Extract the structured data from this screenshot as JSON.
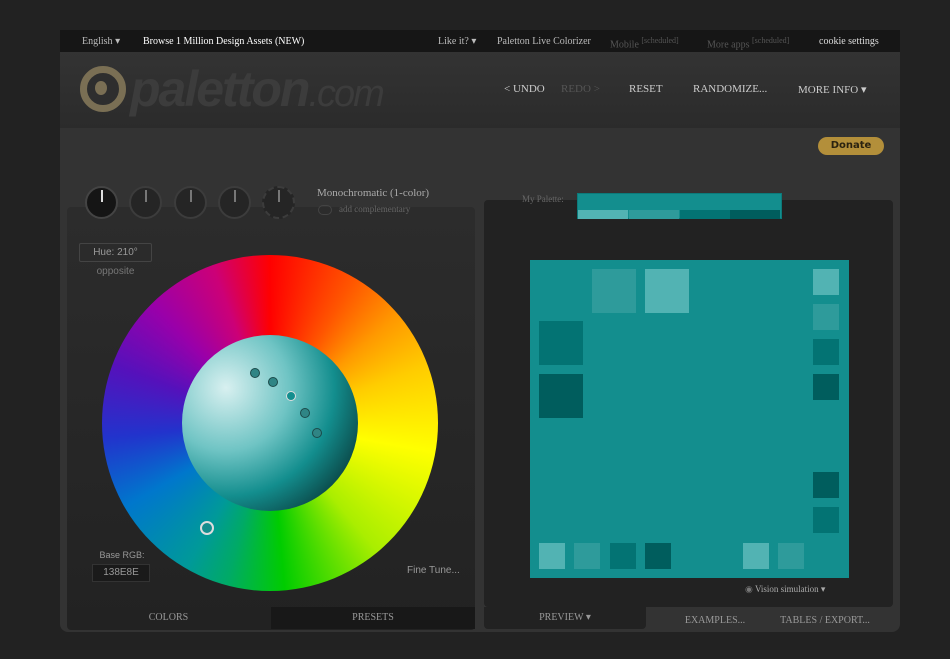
{
  "topbar": {
    "language": "English",
    "browse": "Browse 1 Million Design Assets (NEW)",
    "like": "Like it?",
    "colorizer": "Paletton Live Colorizer",
    "mobile": "Mobile",
    "mobile_tag": "[scheduled]",
    "more_apps": "More apps",
    "more_apps_tag": "[scheduled]",
    "cookie": "cookie settings"
  },
  "header": {
    "logo": "paletton",
    "logo_suffix": ".com",
    "undo": "< UNDO",
    "redo": "REDO >",
    "reset": "RESET",
    "randomize": "RANDOMIZE...",
    "more_info": "MORE INFO"
  },
  "donate": "Donate",
  "left": {
    "scheme": "Monochromatic (1-color)",
    "add_complementary": "add complementary",
    "hue": "Hue: 210°",
    "opposite": "opposite",
    "base_rgb_label": "Base RGB:",
    "base_rgb": "138E8E",
    "fine_tune": "Fine Tune...",
    "tabs": [
      "COLORS",
      "PRESETS"
    ]
  },
  "right": {
    "my_palette": "My Palette:",
    "vision": "Vision simulation",
    "tabs": [
      "PREVIEW",
      "EXAMPLES...",
      "TABLES / EXPORT..."
    ]
  },
  "colors": {
    "base": "#138E8E",
    "light1": "#52B3B3",
    "light2": "#2E9B9B",
    "dark1": "#037373",
    "dark2": "#005D5D",
    "accent": "#B38F3A"
  }
}
